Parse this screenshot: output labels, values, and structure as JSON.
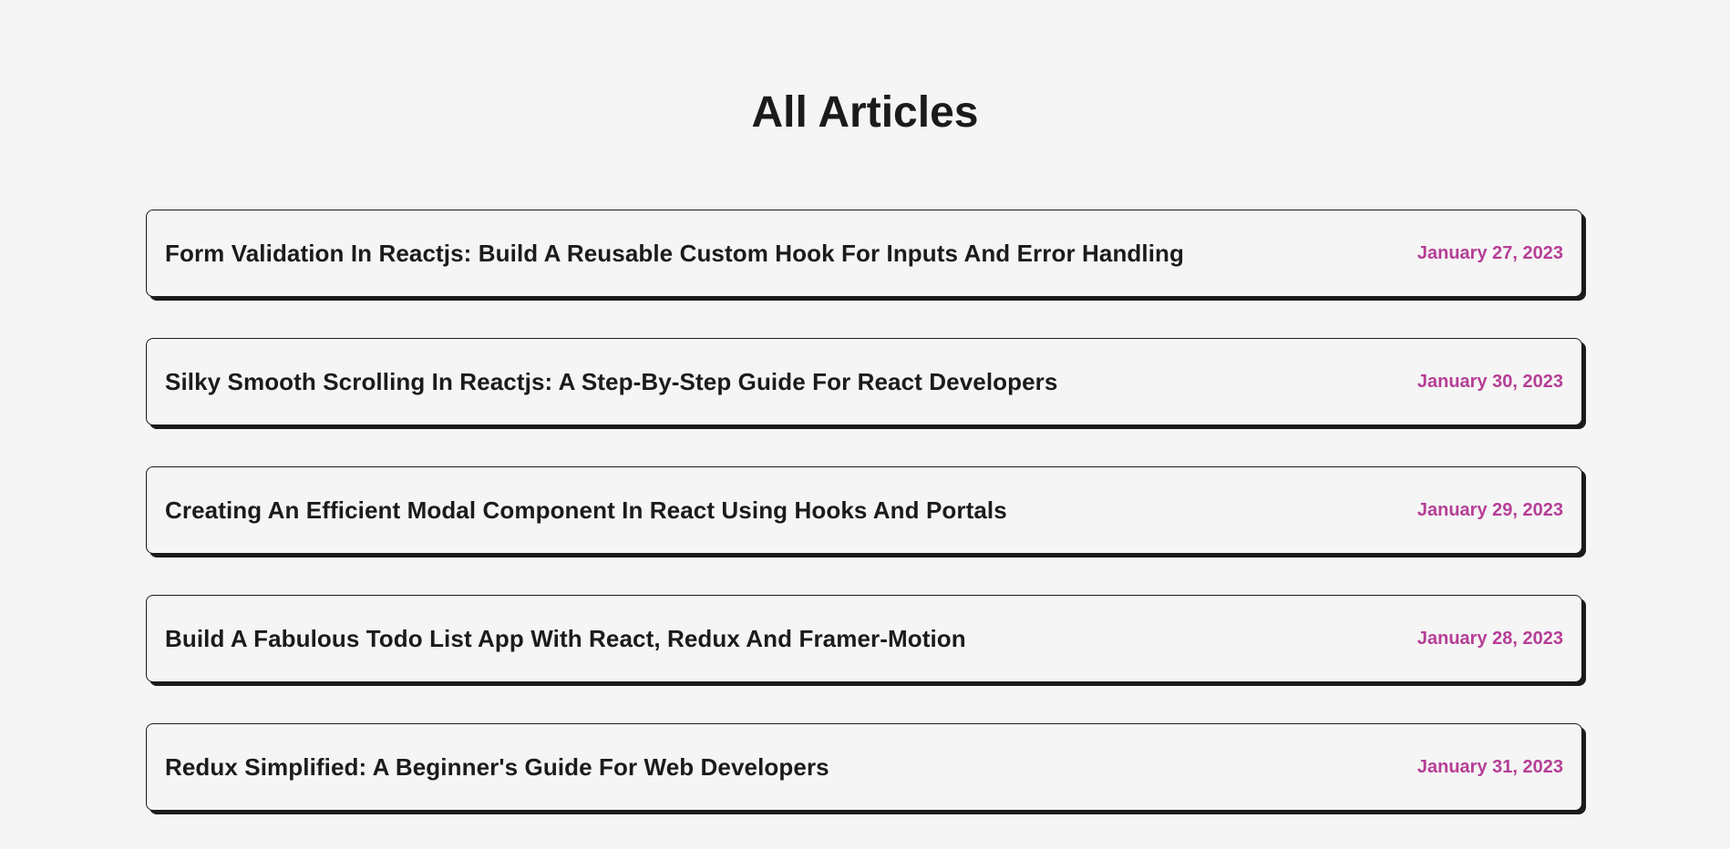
{
  "page": {
    "title": "All Articles"
  },
  "colors": {
    "background": "#f5f5f5",
    "text": "#1b1b1b",
    "accent": "#b63e96"
  },
  "articles": [
    {
      "title": "Form Validation In Reactjs: Build A Reusable Custom Hook For Inputs And Error Handling",
      "date": "January 27, 2023"
    },
    {
      "title": "Silky Smooth Scrolling In Reactjs: A Step-By-Step Guide For React Developers",
      "date": "January 30, 2023"
    },
    {
      "title": "Creating An Efficient Modal Component In React Using Hooks And Portals",
      "date": "January 29, 2023"
    },
    {
      "title": "Build A Fabulous Todo List App With React, Redux And Framer-Motion",
      "date": "January 28, 2023"
    },
    {
      "title": "Redux Simplified: A Beginner's Guide For Web Developers",
      "date": "January 31, 2023"
    }
  ]
}
